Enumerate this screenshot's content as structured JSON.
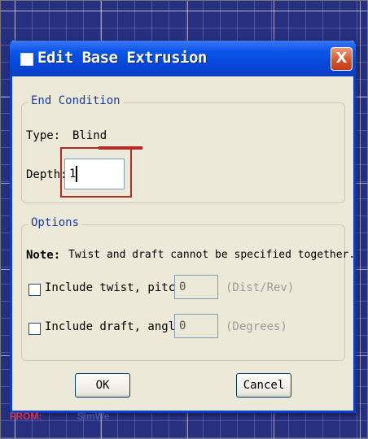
{
  "window": {
    "title": "Edit Base Extrusion",
    "close_glyph": "X"
  },
  "end_condition": {
    "group_label": "End Condition",
    "type_label": "Type:",
    "type_value": "Blind",
    "depth_label": "Depth:",
    "depth_value": "1"
  },
  "options": {
    "group_label": "Options",
    "note_label": "Note:",
    "note_text": "Twist and draft cannot be specified together.",
    "twist": {
      "checked": false,
      "label": "Include twist, pitch:",
      "value": "0",
      "unit": "(Dist/Rev)"
    },
    "draft": {
      "checked": false,
      "label": "Include draft, angle:",
      "value": "0",
      "unit": "(Degrees)"
    }
  },
  "buttons": {
    "ok_label": "OK",
    "cancel_label": "Cancel"
  },
  "watermark": {
    "prefix": "FROM:",
    "site": "SimWe"
  },
  "colors": {
    "titlebar": "#0546d8",
    "dialog_bg": "#ece9d8",
    "viewport_bg": "#26307f",
    "highlight": "#b22a2a"
  }
}
